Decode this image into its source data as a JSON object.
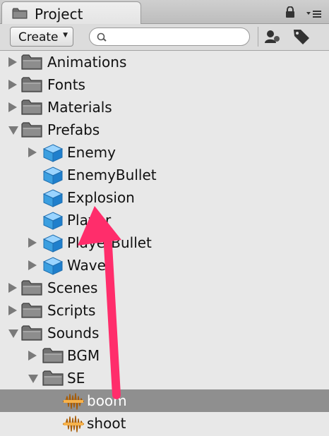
{
  "panel": {
    "title": "Project"
  },
  "toolbar": {
    "create_label": "Create",
    "search_placeholder": "",
    "search_value": ""
  },
  "tree": [
    {
      "label": "Animations",
      "kind": "folder",
      "depth": 0,
      "arrow": "right"
    },
    {
      "label": "Fonts",
      "kind": "folder",
      "depth": 0,
      "arrow": "right"
    },
    {
      "label": "Materials",
      "kind": "folder",
      "depth": 0,
      "arrow": "right"
    },
    {
      "label": "Prefabs",
      "kind": "folder",
      "depth": 0,
      "arrow": "down"
    },
    {
      "label": "Enemy",
      "kind": "prefab",
      "depth": 1,
      "arrow": "right"
    },
    {
      "label": "EnemyBullet",
      "kind": "prefab",
      "depth": 1,
      "arrow": "none"
    },
    {
      "label": "Explosion",
      "kind": "prefab",
      "depth": 1,
      "arrow": "none"
    },
    {
      "label": "Player",
      "kind": "prefab",
      "depth": 1,
      "arrow": "none"
    },
    {
      "label": "PlayerBullet",
      "kind": "prefab",
      "depth": 1,
      "arrow": "right"
    },
    {
      "label": "Wave",
      "kind": "prefab",
      "depth": 1,
      "arrow": "right"
    },
    {
      "label": "Scenes",
      "kind": "folder",
      "depth": 0,
      "arrow": "right"
    },
    {
      "label": "Scripts",
      "kind": "folder",
      "depth": 0,
      "arrow": "right"
    },
    {
      "label": "Sounds",
      "kind": "folder",
      "depth": 0,
      "arrow": "down"
    },
    {
      "label": "BGM",
      "kind": "folder",
      "depth": 1,
      "arrow": "right"
    },
    {
      "label": "SE",
      "kind": "folder",
      "depth": 1,
      "arrow": "down"
    },
    {
      "label": "boom",
      "kind": "audio",
      "depth": 2,
      "arrow": "none",
      "selected": true
    },
    {
      "label": "shoot",
      "kind": "audio",
      "depth": 2,
      "arrow": "none"
    }
  ],
  "colors": {
    "selection": "#8f8f8f",
    "annotation_arrow": "#ff2d6b",
    "prefab_icon": "#3b9fe0",
    "audio_icon": "#f39a1f"
  },
  "icons": {
    "folder": "folder-icon",
    "prefab": "prefab-cube-icon",
    "audio": "audio-clip-icon"
  }
}
